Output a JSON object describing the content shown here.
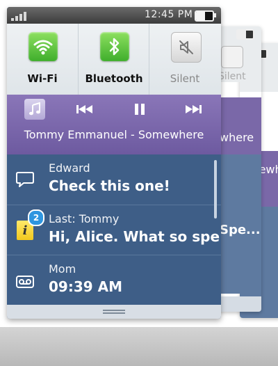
{
  "status_bar": {
    "time": "12:45 PM",
    "battery_level": 0.55
  },
  "quick_settings": [
    {
      "label": "Wi-Fi",
      "icon": "wifi-icon",
      "state": "on"
    },
    {
      "label": "Bluetooth",
      "icon": "bluetooth-icon",
      "state": "on"
    },
    {
      "label": "Silent",
      "icon": "silent-icon",
      "state": "off"
    }
  ],
  "music": {
    "track": "Tommy Emmanuel - Somewhere",
    "controls": [
      "previous-icon",
      "pause-icon",
      "next-icon"
    ]
  },
  "notifications": [
    {
      "icon": "message-bubble-icon",
      "title": "Edward",
      "body": "Check this one!"
    },
    {
      "icon": "info-icon",
      "badge": "2",
      "title": "Last: Tommy",
      "body": "Hi, Alice. What so spe..."
    },
    {
      "icon": "voicemail-icon",
      "title": "Mom",
      "body": "09:39 AM"
    }
  ],
  "background_panels": {
    "text_1": "Silent",
    "text_2": "where",
    "text_3": "mewhere",
    "text_4": "Spe..."
  },
  "colors": {
    "music_bar": "#7a66aa",
    "notifications": "#3e5e87",
    "quick_settings": "#e6eaed",
    "toggle_on": "#4cb832"
  }
}
